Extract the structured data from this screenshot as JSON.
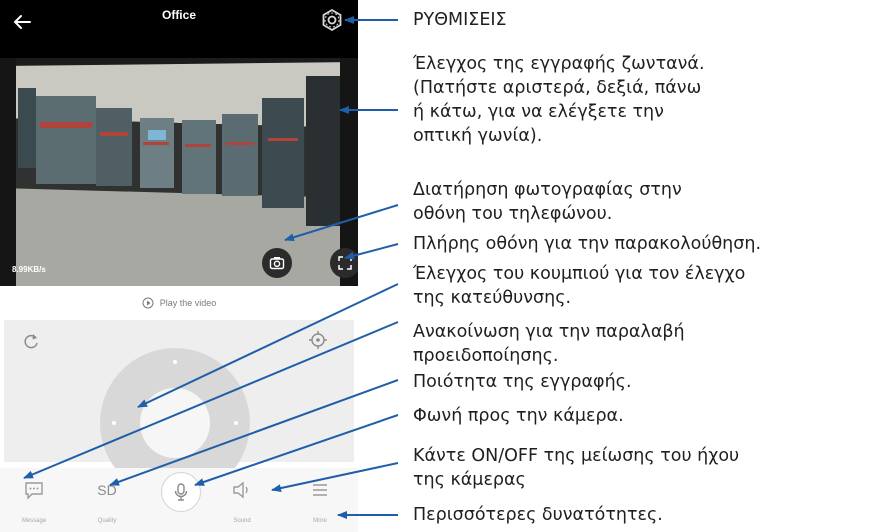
{
  "app": {
    "title": "Office",
    "speed": "8.99KB/s",
    "play_label": "Play the video"
  },
  "toolbar": {
    "items": [
      {
        "label": "Message",
        "icon": "message-icon"
      },
      {
        "label": "Quality",
        "icon": "sd-icon",
        "text": "SD"
      },
      {
        "label": "",
        "icon": "microphone-icon"
      },
      {
        "label": "Sound",
        "icon": "speaker-icon"
      },
      {
        "label": "More",
        "icon": "menu-icon"
      }
    ]
  },
  "annotations": {
    "settings": "ΡΥΘΜΙΣΕΙΣ",
    "live_control": [
      "Έλεγχος της εγγραφής ζωντανά.",
      "(Πατήστε αριστερά, δεξιά, πάνω",
      "ή κάτω, για να ελέγξετε την",
      "οπτική γωνία)."
    ],
    "snapshot": [
      "Διατήρηση φωτογραφίας στην",
      "οθόνη του τηλεφώνου."
    ],
    "fullscreen": "Πλήρης οθόνη για την παρακολούθηση.",
    "direction": [
      "Έλεγχος του κουμπιού για τον έλεγχο",
      "της κατεύθυνσης."
    ],
    "message": [
      "Ανακοίνωση για την παραλαβή",
      "προειδοποίησης."
    ],
    "quality": "Ποιότητα της εγγραφής.",
    "voice": "Φωνή προς την κάμερα.",
    "sound": [
      "Κάντε ON/OFF της μείωσης του ήχου",
      "της κάμερας"
    ],
    "more": "Περισσότερες δυνατότητες."
  },
  "colors": {
    "arrow": "#1f5ea8",
    "topbar": "#000000",
    "control_bg": "#eeeeee",
    "joystick": "#d8d8d8"
  }
}
